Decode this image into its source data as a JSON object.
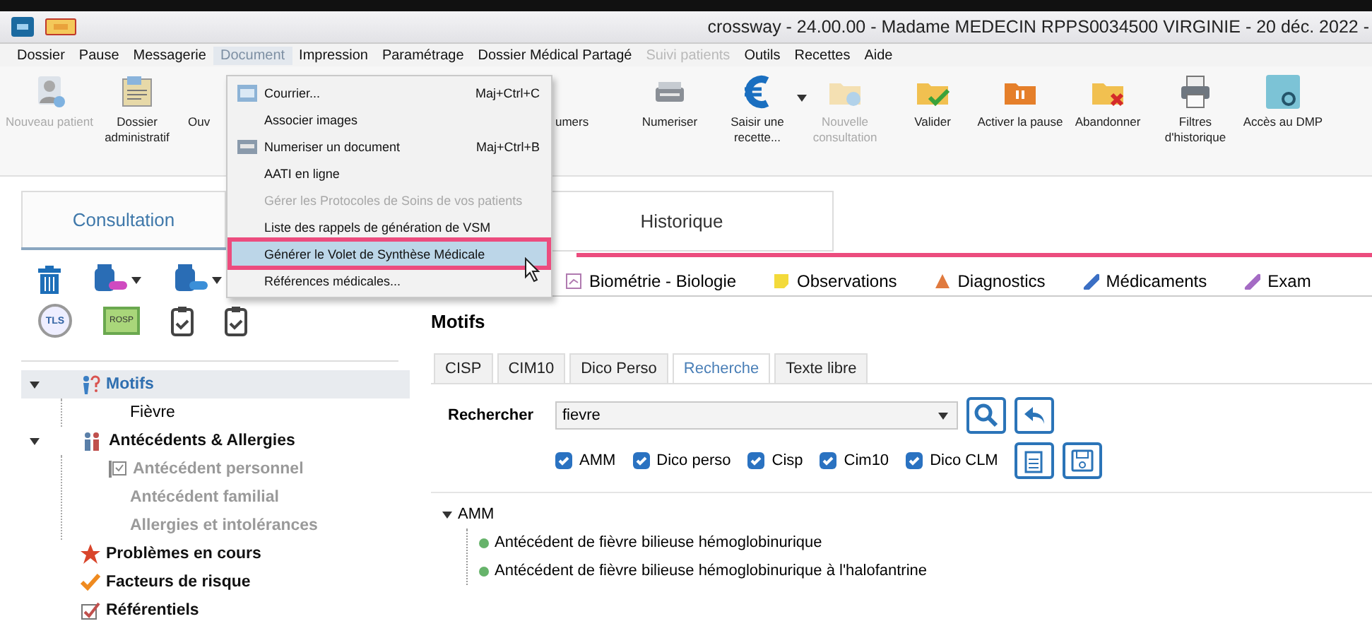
{
  "window": {
    "title": "crossway  - 24.00.00 - Madame MEDECIN RPPS0034500 VIRGINIE - 20 déc. 2022 -"
  },
  "menu_bar": [
    {
      "label": "Dossier",
      "disabled": false,
      "open": false
    },
    {
      "label": "Pause",
      "disabled": false,
      "open": false
    },
    {
      "label": "Messagerie",
      "disabled": false,
      "open": false
    },
    {
      "label": "Document",
      "disabled": false,
      "open": true
    },
    {
      "label": "Impression",
      "disabled": false,
      "open": false
    },
    {
      "label": "Paramétrage",
      "disabled": false,
      "open": false
    },
    {
      "label": "Dossier Médical Partagé",
      "disabled": false,
      "open": false
    },
    {
      "label": "Suivi patients",
      "disabled": true,
      "open": false
    },
    {
      "label": "Outils",
      "disabled": false,
      "open": false
    },
    {
      "label": "Recettes",
      "disabled": false,
      "open": false
    },
    {
      "label": "Aide",
      "disabled": false,
      "open": false
    }
  ],
  "toolbar": [
    {
      "kind": "button",
      "label": "Nouveau patient",
      "disabled": true,
      "dropdown": false
    },
    {
      "kind": "button",
      "label": "Dossier administratif",
      "disabled": false,
      "dropdown": false
    },
    {
      "kind": "cut",
      "label": "Ouv",
      "disabled": false,
      "dropdown": false
    },
    {
      "kind": "cut",
      "label": "umers",
      "disabled": false,
      "dropdown": false
    },
    {
      "kind": "button",
      "label": "Numeriser",
      "disabled": false,
      "dropdown": false
    },
    {
      "kind": "button",
      "label": "Saisir une recette...",
      "disabled": false,
      "dropdown": true
    },
    {
      "kind": "button",
      "label": "Nouvelle consultation",
      "disabled": true,
      "dropdown": false
    },
    {
      "kind": "button",
      "label": "Valider",
      "disabled": false,
      "dropdown": false
    },
    {
      "kind": "button",
      "label": "Activer la pause",
      "disabled": false,
      "dropdown": false
    },
    {
      "kind": "button",
      "label": "Abandonner",
      "disabled": false,
      "dropdown": false
    },
    {
      "kind": "button",
      "label": "Filtres d'historique",
      "disabled": false,
      "dropdown": false
    },
    {
      "kind": "button",
      "label": "Accès au DMP",
      "disabled": false,
      "dropdown": false
    }
  ],
  "document_menu": [
    {
      "label": "Courrier...",
      "shortcut": "Maj+Ctrl+C",
      "disabled": false,
      "selected": false
    },
    {
      "label": "Associer images",
      "disabled": false,
      "selected": false
    },
    {
      "label": "Numeriser un document",
      "shortcut": "Maj+Ctrl+B",
      "disabled": false,
      "selected": false
    },
    {
      "label": "AATI en ligne",
      "disabled": false,
      "selected": false
    },
    {
      "label": "Gérer les Protocoles de Soins de vos patients",
      "disabled": true,
      "selected": false
    },
    {
      "label": "Liste des rappels de génération de VSM",
      "disabled": false,
      "selected": false
    },
    {
      "label": "Générer le Volet de Synthèse Médicale",
      "disabled": false,
      "selected": true
    },
    {
      "label": "Références médicales...",
      "disabled": false,
      "selected": false
    }
  ],
  "main_tabs": [
    {
      "label": "Consultation",
      "selected": true
    },
    {
      "label": "Historique",
      "selected": false
    }
  ],
  "left_tools": [
    [
      {
        "kind": "trash",
        "dropdown": false
      },
      {
        "kind": "pills",
        "dropdown": true
      },
      {
        "kind": "pills",
        "dropdown": true
      }
    ],
    [
      {
        "kind": "round-badge",
        "text": "TLS",
        "dropdown": false
      },
      {
        "kind": "rect-badge",
        "text": "ROSP",
        "dropdown": false
      },
      {
        "kind": "clipboard",
        "dropdown": false
      },
      {
        "kind": "clipboard",
        "dropdown": false
      }
    ]
  ],
  "left_tree": [
    {
      "label": "Motifs",
      "selected": true,
      "disabled": false,
      "expanded": true,
      "children": [
        {
          "label": "Fièvre",
          "selected": false,
          "disabled": false
        }
      ]
    },
    {
      "label": "Antécédents & Allergies",
      "selected": false,
      "disabled": false,
      "expanded": true,
      "children": [
        {
          "label": "Antécédent personnel",
          "selected": false,
          "disabled": true
        },
        {
          "label": "Antécédent familial",
          "selected": false,
          "disabled": true
        },
        {
          "label": "Allergies et intolérances",
          "selected": false,
          "disabled": true
        }
      ]
    },
    {
      "label": "Problèmes en cours",
      "selected": false,
      "disabled": false
    },
    {
      "label": "Facteurs de risque",
      "selected": false,
      "disabled": false
    },
    {
      "label": "Référentiels",
      "selected": false,
      "disabled": false
    }
  ],
  "category_tabs": [
    "Biométrie - Biologie",
    "Observations",
    "Diagnostics",
    "Médicaments",
    "Exam"
  ],
  "section_title": "Motifs",
  "sub_tabs": [
    {
      "label": "CISP",
      "selected": false
    },
    {
      "label": "CIM10",
      "selected": false
    },
    {
      "label": "Dico Perso",
      "selected": false
    },
    {
      "label": "Recherche",
      "selected": true
    },
    {
      "label": "Texte libre",
      "selected": false
    }
  ],
  "search": {
    "label": "Rechercher",
    "value": "fievre"
  },
  "filters": [
    {
      "label": "AMM",
      "checked": true
    },
    {
      "label": "Dico perso",
      "checked": true
    },
    {
      "label": "Cisp",
      "checked": true
    },
    {
      "label": "Cim10",
      "checked": true
    },
    {
      "label": "Dico CLM",
      "checked": true
    }
  ],
  "results": [
    {
      "label": "AMM",
      "expanded": true,
      "children": [
        {
          "label": "Antécédent de fièvre bilieuse hémoglobinurique"
        },
        {
          "label": "Antécédent de fièvre bilieuse hémoglobinurique à l'halofantrine"
        }
      ]
    }
  ]
}
